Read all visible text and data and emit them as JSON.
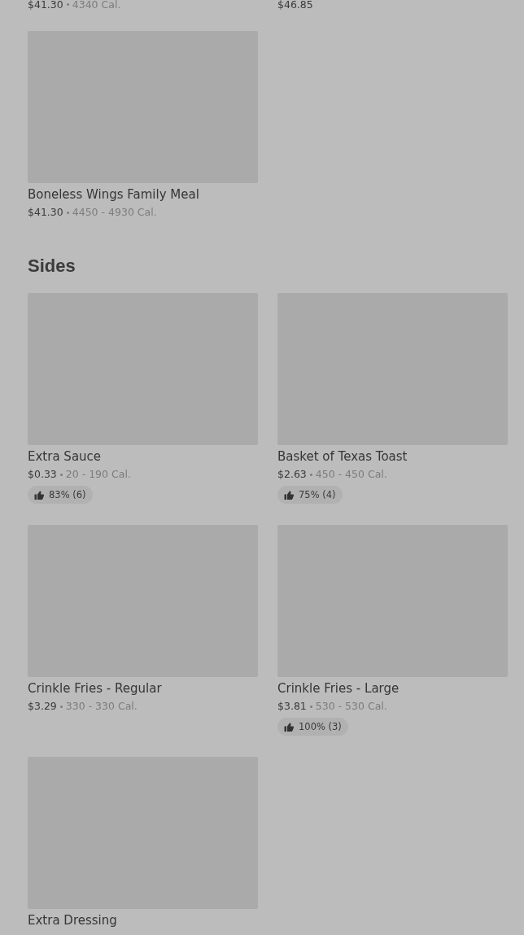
{
  "sections": [
    {
      "items": [
        {
          "kind": "cut",
          "price": "$41.30",
          "calories": "4340 Cal."
        },
        {
          "kind": "cut",
          "price": "$46.85"
        },
        {
          "kind": "card",
          "name": "Boneless Wings Family Meal",
          "price": "$41.30",
          "calories": "4450 - 4930 Cal."
        }
      ]
    },
    {
      "title": "Sides",
      "items": [
        {
          "kind": "card",
          "name": "Extra Sauce",
          "price": "$0.33",
          "calories": "20 - 190 Cal.",
          "rating": "83% (6)"
        },
        {
          "kind": "card",
          "name": "Basket of Texas Toast",
          "price": "$2.63",
          "calories": "450 - 450 Cal.",
          "rating": "75% (4)"
        },
        {
          "kind": "card",
          "name": "Crinkle Fries - Regular",
          "price": "$3.29",
          "calories": "330 - 330 Cal."
        },
        {
          "kind": "card",
          "name": "Crinkle Fries - Large",
          "price": "$3.81",
          "calories": "530 - 530 Cal.",
          "rating": "100% (3)"
        },
        {
          "kind": "card",
          "name": "Extra Dressing"
        }
      ]
    }
  ]
}
